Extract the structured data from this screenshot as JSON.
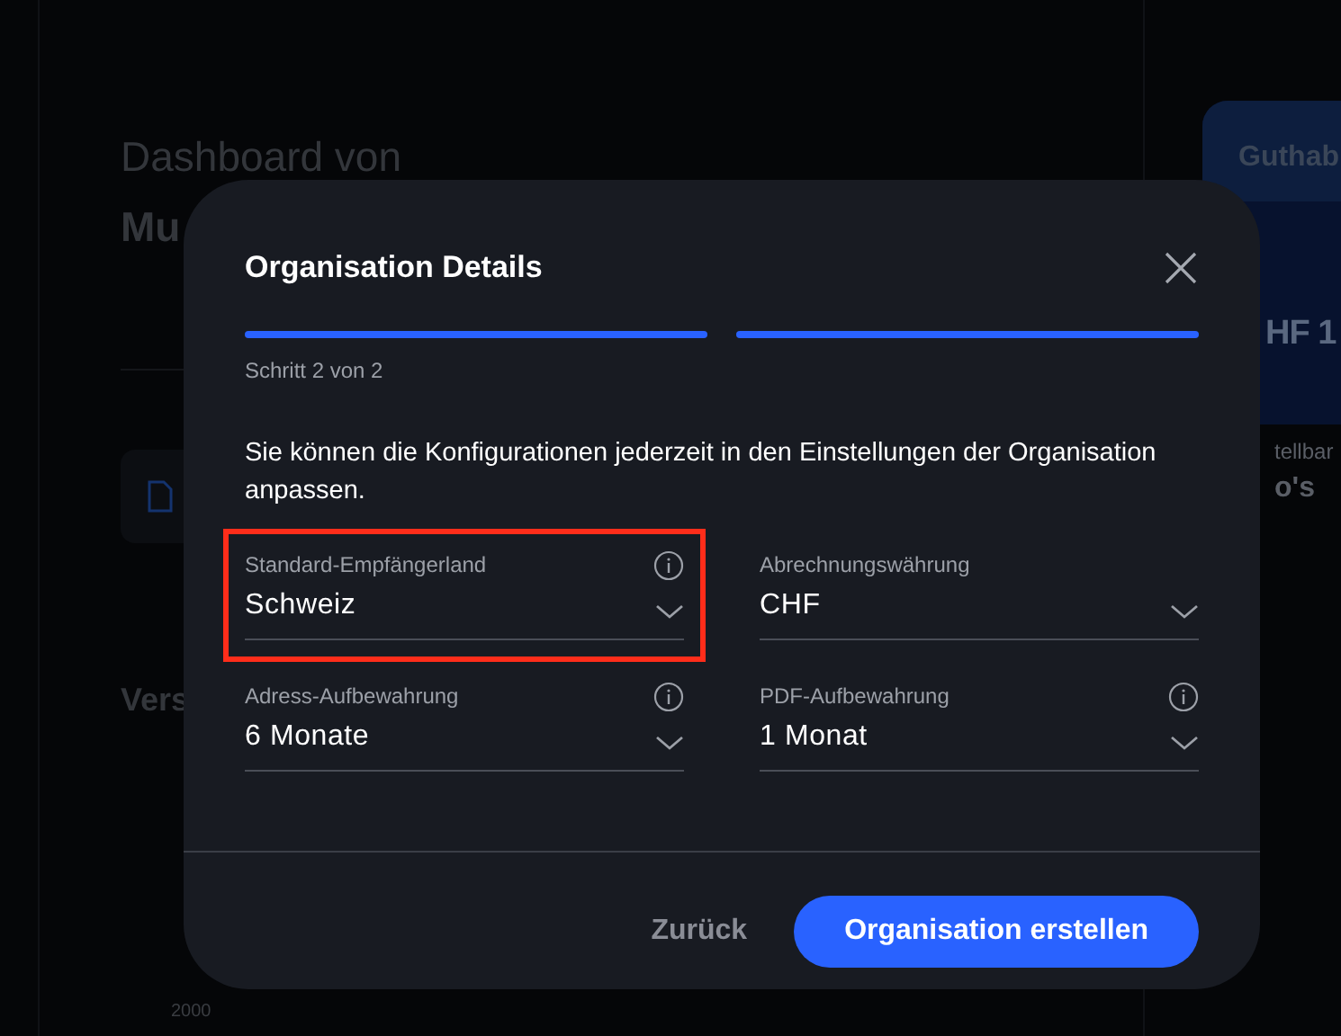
{
  "background": {
    "heading": "Dashboard von",
    "name": "Mu",
    "section": "Vers",
    "axis_labels": [
      "2000"
    ],
    "balance_card": {
      "title": "Guthab",
      "amount": "HF 1"
    },
    "side_label": "tellbar",
    "side_value": "o's"
  },
  "dialog": {
    "title": "Organisation Details",
    "steps": [
      {
        "done": true
      },
      {
        "done": true
      }
    ],
    "step_label": "Schritt 2 von 2",
    "description": "Sie können die Konfigurationen jederzeit in den Einstellungen der Organisation anpassen.",
    "fields": [
      {
        "label": "Standard-Empfängerland",
        "value": "Schweiz",
        "info": true,
        "highlighted": true
      },
      {
        "label": "Abrechnungswährung",
        "value": "CHF",
        "info": false,
        "highlighted": false
      },
      {
        "label": "Adress-Aufbewahrung",
        "value": "6 Monate",
        "info": true,
        "highlighted": false
      },
      {
        "label": "PDF-Aufbewahrung",
        "value": "1 Monat",
        "info": true,
        "highlighted": false
      }
    ],
    "back_button": "Zurück",
    "submit_button": "Organisation erstellen"
  }
}
